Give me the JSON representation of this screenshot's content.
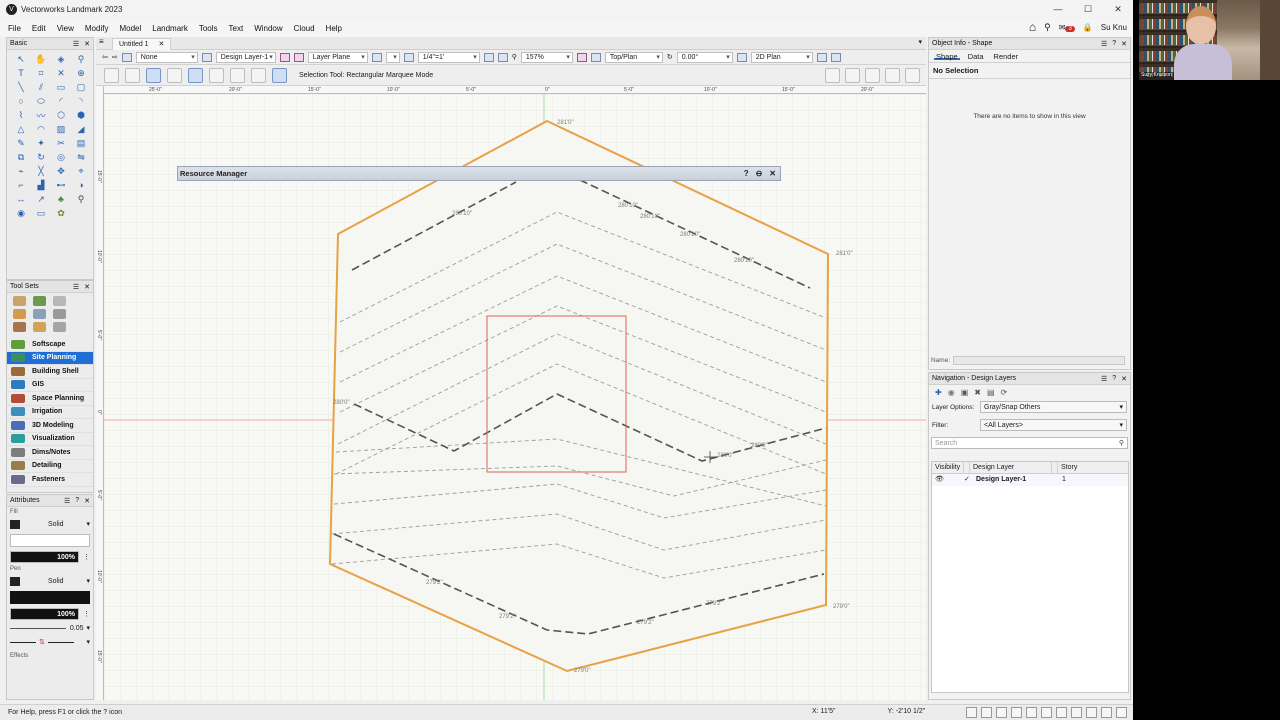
{
  "app": {
    "title": "Vectorworks Landmark 2023",
    "window_controls": [
      "—",
      "☐",
      "✕"
    ]
  },
  "menu": {
    "items": [
      "File",
      "Edit",
      "View",
      "Modify",
      "Model",
      "Landmark",
      "Tools",
      "Text",
      "Window",
      "Cloud",
      "Help"
    ],
    "notification_count": "3",
    "user": "Su Knu"
  },
  "basic_palette": {
    "title": "Basic"
  },
  "toolsets_palette": {
    "title": "Tool Sets",
    "items": [
      {
        "label": "Softscape",
        "color": "#5f9e3a",
        "selected": false
      },
      {
        "label": "Site Planning",
        "color": "#3c8f5d",
        "selected": true
      },
      {
        "label": "Building Shell",
        "color": "#9b6a3a",
        "selected": false
      },
      {
        "label": "GIS",
        "color": "#2f7bbf",
        "selected": false
      },
      {
        "label": "Space Planning",
        "color": "#b24c3a",
        "selected": false
      },
      {
        "label": "Irrigation",
        "color": "#3a8fbf",
        "selected": false
      },
      {
        "label": "3D Modeling",
        "color": "#4a6db3",
        "selected": false
      },
      {
        "label": "Visualization",
        "color": "#2d9c9c",
        "selected": false
      },
      {
        "label": "Dims/Notes",
        "color": "#7d7d7d",
        "selected": false
      },
      {
        "label": "Detailing",
        "color": "#9a7b4a",
        "selected": false
      },
      {
        "label": "Fasteners",
        "color": "#6a6a8a",
        "selected": false
      }
    ]
  },
  "attributes": {
    "title": "Attributes",
    "fill_label": "Fill",
    "fill_style": "Solid",
    "fill_opacity": "100%",
    "pen_label": "Pen",
    "pen_style": "Solid",
    "pen_opacity": "100%",
    "line_weight": "0.05",
    "effects_label": "Effects"
  },
  "document": {
    "tab_title": "Untitled 1",
    "tab_close": "✕"
  },
  "view_bar": {
    "class": "None",
    "layer": "Design Layer-1",
    "plane": "Layer Plane",
    "scale": "1/4\"=1'",
    "zoom": "157%",
    "view": "Top/Plan",
    "rotation": "0.00°",
    "render_mode": "2D Plan"
  },
  "mode_bar": {
    "mode_text": "Selection Tool: Rectangular Marquee Mode"
  },
  "rulers": {
    "top_labels": [
      "25'-0\"",
      "20'-0\"",
      "15'-0\"",
      "10'-0\"",
      "5'-0\"",
      "0\"",
      "5'-0\"",
      "10'-0\"",
      "15'-0\"",
      "20'-0\""
    ],
    "left_labels": [
      "15'-0\"",
      "10'-0\"",
      "5'-0\"",
      "0\"",
      "5'-0\"",
      "10'-0\"",
      "15'-0\""
    ]
  },
  "resource_manager": {
    "title": "Resource Manager",
    "buttons": [
      "?",
      "⊖",
      "✕"
    ]
  },
  "drawing": {
    "elevation_labels": [
      "281'0\"",
      "280'10\"",
      "280'10\"",
      "280'10\"",
      "280'10\"",
      "280'10\"",
      "281'0\"",
      "280'0\"",
      "280'0\"",
      "280'0\"",
      "279'2\"",
      "279'2\"",
      "279'2\"",
      "279'2\"",
      "279'0\"",
      "279'0\""
    ],
    "colors": {
      "boundary": "#e8a145",
      "major_contour": "#4b5a4b",
      "minor_contour": "#9c9c9c",
      "selection_box": "#d9664f",
      "grid": "#dde6d8"
    }
  },
  "object_info": {
    "title": "Object Info - Shape",
    "tabs": [
      "Shape",
      "Data",
      "Render"
    ],
    "selection": "No Selection",
    "empty_message": "There are no items to show in this view",
    "name_label": "Name:"
  },
  "navigation": {
    "title": "Navigation - Design Layers",
    "layer_options_label": "Layer Options:",
    "layer_options_value": "Gray/Snap Others",
    "filter_label": "Filter:",
    "filter_value": "<All Layers>",
    "search_placeholder": "Search",
    "columns": [
      "Visibility",
      "Design Layer",
      "Story"
    ],
    "rows": [
      {
        "check": "✓",
        "name": "Design Layer-1",
        "index": "1"
      }
    ]
  },
  "status_bar": {
    "help_text": "For Help, press F1 or click the ? icon",
    "x_coord": "X: 11'5\"",
    "y_coord": "Y: -2'10 1/2\""
  },
  "webcam": {
    "name_label": "Suzy Knutson"
  }
}
